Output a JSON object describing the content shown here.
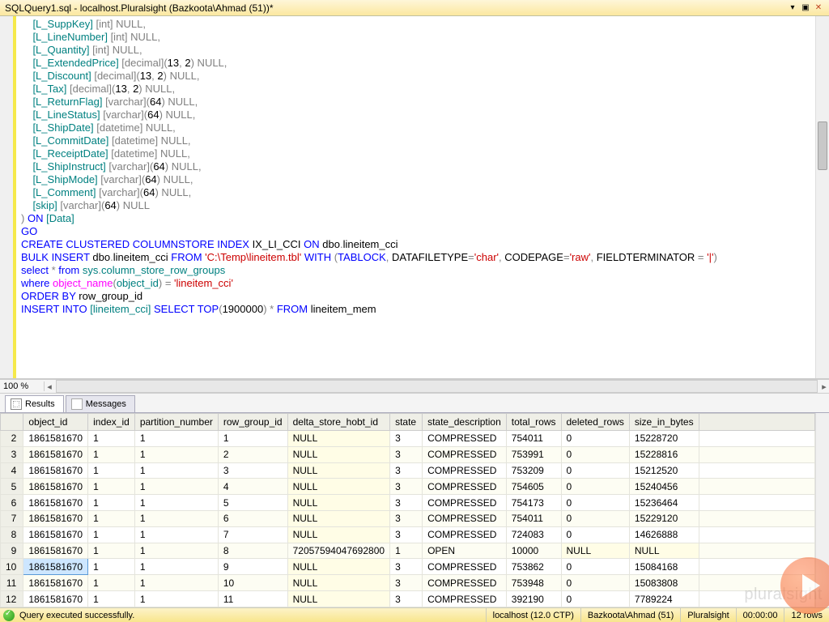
{
  "tab": {
    "title": "SQLQuery1.sql - localhost.Pluralsight (Bazkoota\\Ahmad (51))*"
  },
  "editor": {
    "zoom": "100 %",
    "lines": [
      [
        [
          "obj",
          "    [L_SuppKey]"
        ],
        [
          "gray",
          " [int] NULL"
        ],
        [
          "gray",
          ","
        ]
      ],
      [
        [
          "obj",
          "    [L_LineNumber]"
        ],
        [
          "gray",
          " [int] NULL"
        ],
        [
          "gray",
          ","
        ]
      ],
      [
        [
          "obj",
          "    [L_Quantity]"
        ],
        [
          "gray",
          " [int] NULL"
        ],
        [
          "gray",
          ","
        ]
      ],
      [
        [
          "obj",
          "    [L_ExtendedPrice]"
        ],
        [
          "gray",
          " [decimal]"
        ],
        [
          "gray",
          "("
        ],
        [
          "num",
          "13"
        ],
        [
          "gray",
          ", "
        ],
        [
          "num",
          "2"
        ],
        [
          "gray",
          ") NULL,"
        ]
      ],
      [
        [
          "obj",
          "    [L_Discount]"
        ],
        [
          "gray",
          " [decimal]"
        ],
        [
          "gray",
          "("
        ],
        [
          "num",
          "13"
        ],
        [
          "gray",
          ", "
        ],
        [
          "num",
          "2"
        ],
        [
          "gray",
          ") NULL,"
        ]
      ],
      [
        [
          "obj",
          "    [L_Tax]"
        ],
        [
          "gray",
          " [decimal]"
        ],
        [
          "gray",
          "("
        ],
        [
          "num",
          "13"
        ],
        [
          "gray",
          ", "
        ],
        [
          "num",
          "2"
        ],
        [
          "gray",
          ") NULL,"
        ]
      ],
      [
        [
          "obj",
          "    [L_ReturnFlag]"
        ],
        [
          "gray",
          " [varchar]"
        ],
        [
          "gray",
          "("
        ],
        [
          "num",
          "64"
        ],
        [
          "gray",
          ") NULL,"
        ]
      ],
      [
        [
          "obj",
          "    [L_LineStatus]"
        ],
        [
          "gray",
          " [varchar]"
        ],
        [
          "gray",
          "("
        ],
        [
          "num",
          "64"
        ],
        [
          "gray",
          ") NULL,"
        ]
      ],
      [
        [
          "obj",
          "    [L_ShipDate]"
        ],
        [
          "gray",
          " [datetime] NULL,"
        ]
      ],
      [
        [
          "obj",
          "    [L_CommitDate]"
        ],
        [
          "gray",
          " [datetime] NULL,"
        ]
      ],
      [
        [
          "obj",
          "    [L_ReceiptDate]"
        ],
        [
          "gray",
          " [datetime] NULL,"
        ]
      ],
      [
        [
          "obj",
          "    [L_ShipInstruct]"
        ],
        [
          "gray",
          " [varchar]"
        ],
        [
          "gray",
          "("
        ],
        [
          "num",
          "64"
        ],
        [
          "gray",
          ") NULL,"
        ]
      ],
      [
        [
          "obj",
          "    [L_ShipMode]"
        ],
        [
          "gray",
          " [varchar]"
        ],
        [
          "gray",
          "("
        ],
        [
          "num",
          "64"
        ],
        [
          "gray",
          ") NULL,"
        ]
      ],
      [
        [
          "obj",
          "    [L_Comment]"
        ],
        [
          "gray",
          " [varchar]"
        ],
        [
          "gray",
          "("
        ],
        [
          "num",
          "64"
        ],
        [
          "gray",
          ") NULL,"
        ]
      ],
      [
        [
          "obj",
          "    [skip]"
        ],
        [
          "gray",
          " [varchar]"
        ],
        [
          "gray",
          "("
        ],
        [
          "num",
          "64"
        ],
        [
          "gray",
          ") NULL"
        ]
      ],
      [
        [
          "gray",
          ") "
        ],
        [
          "kw",
          "ON "
        ],
        [
          "obj",
          "[Data]"
        ]
      ],
      [
        [
          "kw",
          "GO"
        ]
      ],
      [
        [
          "",
          ""
        ]
      ],
      [
        [
          "kw",
          "CREATE CLUSTERED COLUMNSTORE INDEX"
        ],
        [
          "",
          " IX_LI_CCI "
        ],
        [
          "kw",
          "ON"
        ],
        [
          "",
          " dbo"
        ],
        [
          "gray",
          "."
        ],
        [
          "",
          "lineitem_cci"
        ]
      ],
      [
        [
          "",
          ""
        ]
      ],
      [
        [
          "kw",
          "BULK INSERT"
        ],
        [
          "",
          " dbo"
        ],
        [
          "gray",
          "."
        ],
        [
          "",
          "lineitem_cci "
        ],
        [
          "kw",
          "FROM "
        ],
        [
          "str",
          "'C:\\Temp\\lineitem.tbl'"
        ],
        [
          "kw",
          " WITH "
        ],
        [
          "gray",
          "("
        ],
        [
          "kw",
          "TABLOCK"
        ],
        [
          "gray",
          ", "
        ],
        [
          "",
          "DATAFILETYPE"
        ],
        [
          "gray",
          "="
        ],
        [
          "str",
          "'char'"
        ],
        [
          "gray",
          ", "
        ],
        [
          "",
          "CODEPAGE"
        ],
        [
          "gray",
          "="
        ],
        [
          "str",
          "'raw'"
        ],
        [
          "gray",
          ", "
        ],
        [
          "",
          "FIELDTERMINATOR "
        ],
        [
          "gray",
          "= "
        ],
        [
          "str",
          "'|'"
        ],
        [
          "gray",
          ")"
        ]
      ],
      [
        [
          "",
          ""
        ]
      ],
      [
        [
          "kw",
          "select "
        ],
        [
          "gray",
          "*"
        ],
        [
          "kw",
          " from "
        ],
        [
          "obj",
          "sys"
        ],
        [
          "gray",
          "."
        ],
        [
          "obj",
          "column_store_row_groups"
        ]
      ],
      [
        [
          "kw",
          "where "
        ],
        [
          "fn",
          "object_name"
        ],
        [
          "gray",
          "("
        ],
        [
          "obj",
          "object_id"
        ],
        [
          "gray",
          ") "
        ],
        [
          "gray",
          "= "
        ],
        [
          "str",
          "'lineitem_cci'"
        ]
      ],
      [
        [
          "kw",
          "ORDER BY"
        ],
        [
          "",
          " row_group_id"
        ]
      ],
      [
        [
          "",
          ""
        ]
      ],
      [
        [
          "kw",
          "INSERT INTO "
        ],
        [
          "obj",
          "[lineitem_cci] "
        ],
        [
          "kw",
          "SELECT "
        ],
        [
          "kw",
          "TOP"
        ],
        [
          "gray",
          "("
        ],
        [
          "num",
          "1900000"
        ],
        [
          "gray",
          ") "
        ],
        [
          "gray",
          "*"
        ],
        [
          "kw",
          " FROM"
        ],
        [
          "",
          " lineitem_mem"
        ]
      ]
    ]
  },
  "tabs": {
    "results": "Results",
    "messages": "Messages"
  },
  "grid": {
    "headers": [
      "object_id",
      "index_id",
      "partition_number",
      "row_group_id",
      "delta_store_hobt_id",
      "state",
      "state_description",
      "total_rows",
      "deleted_rows",
      "size_in_bytes"
    ],
    "rows": [
      {
        "n": "2",
        "c": [
          "1861581670",
          "1",
          "1",
          "1",
          "NULL",
          "3",
          "COMPRESSED",
          "754011",
          "0",
          "15228720"
        ]
      },
      {
        "n": "3",
        "c": [
          "1861581670",
          "1",
          "1",
          "2",
          "NULL",
          "3",
          "COMPRESSED",
          "753991",
          "0",
          "15228816"
        ]
      },
      {
        "n": "4",
        "c": [
          "1861581670",
          "1",
          "1",
          "3",
          "NULL",
          "3",
          "COMPRESSED",
          "753209",
          "0",
          "15212520"
        ]
      },
      {
        "n": "5",
        "c": [
          "1861581670",
          "1",
          "1",
          "4",
          "NULL",
          "3",
          "COMPRESSED",
          "754605",
          "0",
          "15240456"
        ]
      },
      {
        "n": "6",
        "c": [
          "1861581670",
          "1",
          "1",
          "5",
          "NULL",
          "3",
          "COMPRESSED",
          "754173",
          "0",
          "15236464"
        ]
      },
      {
        "n": "7",
        "c": [
          "1861581670",
          "1",
          "1",
          "6",
          "NULL",
          "3",
          "COMPRESSED",
          "754011",
          "0",
          "15229120"
        ]
      },
      {
        "n": "8",
        "c": [
          "1861581670",
          "1",
          "1",
          "7",
          "NULL",
          "3",
          "COMPRESSED",
          "724083",
          "0",
          "14626888"
        ]
      },
      {
        "n": "9",
        "c": [
          "1861581670",
          "1",
          "1",
          "8",
          "72057594047692800",
          "1",
          "OPEN",
          "10000",
          "NULL",
          "NULL"
        ]
      },
      {
        "n": "10",
        "c": [
          "1861581670",
          "1",
          "1",
          "9",
          "NULL",
          "3",
          "COMPRESSED",
          "753862",
          "0",
          "15084168"
        ],
        "sel": 0
      },
      {
        "n": "11",
        "c": [
          "1861581670",
          "1",
          "1",
          "10",
          "NULL",
          "3",
          "COMPRESSED",
          "753948",
          "0",
          "15083808"
        ]
      },
      {
        "n": "12",
        "c": [
          "1861581670",
          "1",
          "1",
          "11",
          "NULL",
          "3",
          "COMPRESSED",
          "392190",
          "0",
          "7789224"
        ]
      }
    ]
  },
  "status": {
    "msg": "Query executed successfully.",
    "server": "localhost (12.0 CTP)",
    "user": "Bazkoota\\Ahmad (51)",
    "db": "Pluralsight",
    "time": "00:00:00",
    "rows": "12 rows"
  },
  "watermark": "pluralsight"
}
